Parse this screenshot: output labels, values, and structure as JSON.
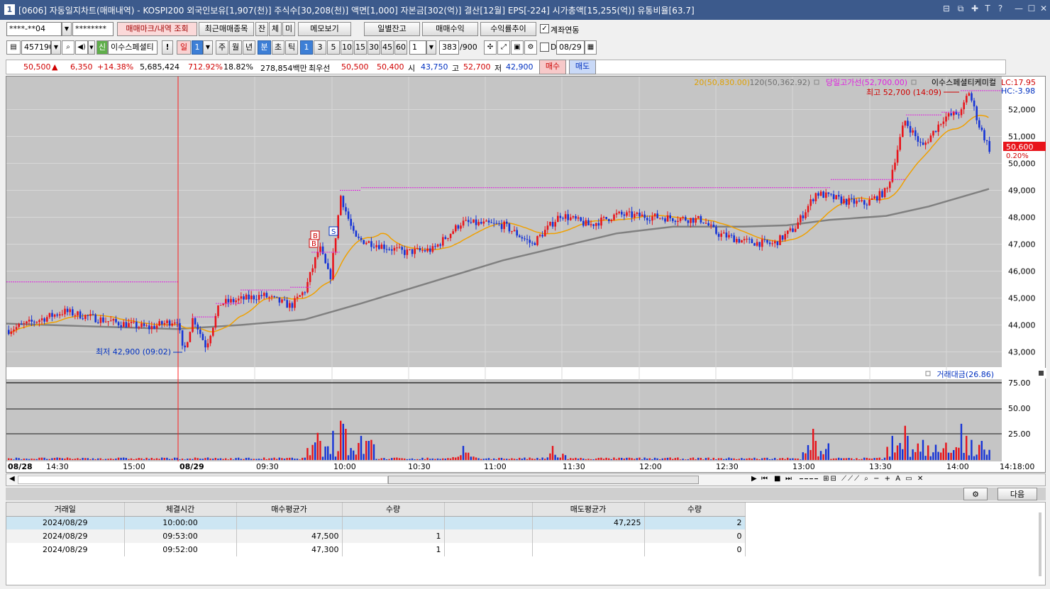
{
  "window": {
    "title": "[0606] 자동일지차트(매매내역) - KOSPI200 외국인보유[1,907(천)] 주식수[30,208(천)] 액면[1,000] 자본금[302(억)] 결산[12월] EPS[-224] 시가총액[15,255(억)] 유통비율[63.7]",
    "icon_label": "1"
  },
  "toolbar1": {
    "account": "****-**04",
    "password": "********",
    "mark_btn": "매매마크/내역 조회",
    "recent_btn": "최근매매종목",
    "jan": "잔",
    "che": "체",
    "mi": "미",
    "memo_btn": "메모보기",
    "daily_btn": "일별잔고",
    "trade_btn": "매매수익",
    "profit_btn": "수익률추이",
    "link_label": "계좌연동"
  },
  "toolbar2": {
    "code": "457190",
    "sin": "신",
    "stock_name": "이수스페셜티",
    "excl": "!",
    "day": "일",
    "day_num": "1",
    "week": "주",
    "month": "월",
    "year": "년",
    "minute": "분",
    "second": "초",
    "tick": "틱",
    "intervals": [
      "1",
      "3",
      "5",
      "10",
      "15",
      "30",
      "45",
      "60"
    ],
    "count": "1",
    "bars": "383",
    "max": "/900",
    "d_label": "D",
    "date": "08/29"
  },
  "quote": {
    "price": "50,500",
    "arrow": "▲",
    "change": "6,350",
    "pct": "+14.38%",
    "volume": "5,685,424",
    "vol_pct": "712.92%",
    "turnover": "18.82%",
    "amount": "278,854백만",
    "best_label": "최우선",
    "ask": "50,500",
    "bid": "50,400",
    "open_label": "시",
    "open": "43,750",
    "high_label": "고",
    "high": "52,700",
    "low_label": "저",
    "low": "42,900",
    "buy": "매수",
    "sell": "매도"
  },
  "chart_data": {
    "type": "candlestick",
    "legend": {
      "ma20": "20(50,830.00)",
      "ma120": "120(50,362.92)",
      "dayhigh": "당일고가선(52,700.00)",
      "stock": "이수스페셜티케미컬"
    },
    "lc": "LC:17.95",
    "hc": "HC:-3.98",
    "high_annot": "최고 52,700 (14:09)",
    "low_annot": "최저 42,900 (09:02)",
    "price_label": "50,600",
    "price_pct": "0.20%",
    "y_ticks": [
      "52,000",
      "51,000",
      "50,000",
      "49,000",
      "48,000",
      "47,000",
      "46,000",
      "45,000",
      "44,000",
      "43,000"
    ],
    "volume_title": "거래대금(26.86)",
    "vol_ticks": [
      "75.00",
      "50.00",
      "25.00"
    ],
    "x_ticks": [
      "08/28",
      "14:30",
      "15:00",
      "08/29",
      "09:30",
      "10:00",
      "10:30",
      "11:00",
      "11:30",
      "12:00",
      "12:30",
      "13:00",
      "13:30",
      "14:00"
    ],
    "last_time": "14:18:00",
    "marker_b": "B",
    "marker_s": "S",
    "colors": {
      "up": "#e8141b",
      "down": "#1634d6",
      "ma20": "#f0a000",
      "ma120": "#808080",
      "dayhigh": "#e020e0"
    }
  },
  "bottom": {
    "next": "다음"
  },
  "trades": {
    "headers": [
      "거래일",
      "체결시간",
      "매수평균가",
      "수량",
      "",
      "매도평균가",
      "수량"
    ],
    "rows": [
      [
        "2024/08/29",
        "10:00:00",
        "",
        "",
        "",
        "47,225",
        "2"
      ],
      [
        "2024/08/29",
        "09:53:00",
        "47,500",
        "1",
        "",
        "",
        "0"
      ],
      [
        "2024/08/29",
        "09:52:00",
        "47,300",
        "1",
        "",
        "",
        "0"
      ]
    ]
  }
}
